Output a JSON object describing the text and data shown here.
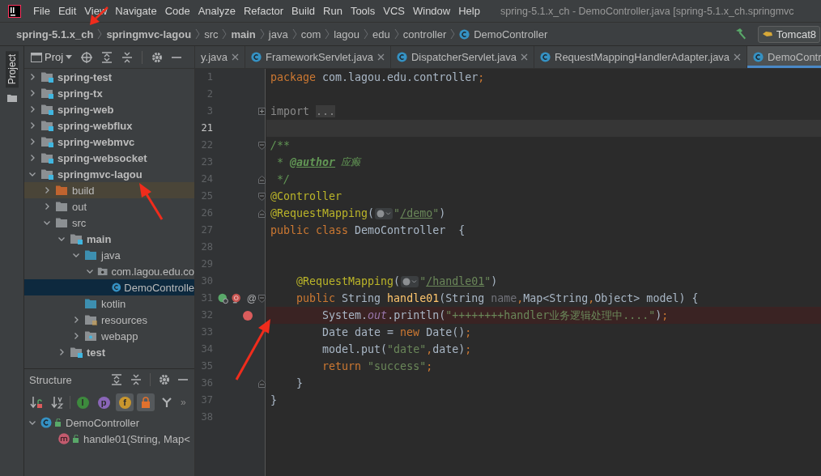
{
  "menu_bar": {
    "items": [
      "File",
      "Edit",
      "View",
      "Navigate",
      "Code",
      "Analyze",
      "Refactor",
      "Build",
      "Run",
      "Tools",
      "VCS",
      "Window",
      "Help"
    ],
    "window_title": "spring-5.1.x_ch - DemoController.java [spring-5.1.x_ch.springmvc"
  },
  "breadcrumb": {
    "items": [
      {
        "text": "spring-5.1.x_ch",
        "bold": true
      },
      {
        "text": "springmvc-lagou",
        "bold": true
      },
      {
        "text": "src",
        "bold": false
      },
      {
        "text": "main",
        "bold": true
      },
      {
        "text": "java",
        "bold": false
      },
      {
        "text": "com",
        "bold": false
      },
      {
        "text": "lagou",
        "bold": false
      },
      {
        "text": "edu",
        "bold": false
      },
      {
        "text": "controller",
        "bold": false
      },
      {
        "text": "DemoController",
        "bold": false,
        "kind": "class"
      }
    ],
    "run_config": "Tomcat8"
  },
  "side_stripe": {
    "tab": "Project"
  },
  "project_panel": {
    "view_selector": "Proj"
  },
  "project_tree": {
    "items": [
      {
        "text": "spring-test",
        "kind": "module",
        "expanded": false,
        "selected": false
      },
      {
        "text": "spring-tx",
        "kind": "module",
        "expanded": false,
        "selected": false
      },
      {
        "text": "spring-web",
        "kind": "module",
        "expanded": false,
        "selected": false
      },
      {
        "text": "spring-webflux",
        "kind": "module",
        "expanded": false,
        "selected": false
      },
      {
        "text": "spring-webmvc",
        "kind": "module",
        "expanded": false,
        "selected": false
      },
      {
        "text": "spring-websocket",
        "kind": "module",
        "expanded": false,
        "selected": false
      },
      {
        "text": "springmvc-lagou",
        "kind": "module",
        "expanded": true,
        "selected": false,
        "children": [
          {
            "text": "build",
            "kind": "excluded",
            "expanded": false,
            "selected": false
          },
          {
            "text": "out",
            "kind": "folder",
            "expanded": false,
            "selected": false
          },
          {
            "text": "src",
            "kind": "folder",
            "expanded": true,
            "selected": false,
            "children": [
              {
                "text": "main",
                "kind": "module-folder",
                "expanded": true,
                "selected": false,
                "children": [
                  {
                    "text": "java",
                    "kind": "source",
                    "expanded": true,
                    "selected": false,
                    "children": [
                      {
                        "text": "com.lagou.edu.co",
                        "kind": "package",
                        "expanded": true,
                        "selected": false,
                        "children": [
                          {
                            "text": "DemoControlle",
                            "kind": "class",
                            "selected": true
                          }
                        ]
                      }
                    ]
                  },
                  {
                    "text": "kotlin",
                    "kind": "source",
                    "selected": false
                  },
                  {
                    "text": "resources",
                    "kind": "resources",
                    "expanded": false,
                    "selected": false
                  },
                  {
                    "text": "webapp",
                    "kind": "web",
                    "expanded": false,
                    "selected": false
                  }
                ]
              },
              {
                "text": "test",
                "kind": "module-folder",
                "expanded": false,
                "selected": false
              }
            ]
          }
        ]
      }
    ]
  },
  "structure_panel": {
    "title": "Structure",
    "toolbar": [
      {
        "kind": "sort-visibility",
        "on": false
      },
      {
        "kind": "sort-alpha",
        "on": false
      },
      {
        "kind": "badge",
        "glyph": "I",
        "on": false
      },
      {
        "kind": "badge",
        "glyph": "p",
        "on": false
      },
      {
        "kind": "badge",
        "glyph": "f",
        "on": true
      },
      {
        "kind": "lock",
        "on": true
      },
      {
        "kind": "hierarchy",
        "on": false
      }
    ],
    "overflow": "»",
    "items": [
      {
        "text": "DemoController",
        "kind": "class",
        "expanded": true,
        "children": [
          {
            "text": "handle01(String, Map<",
            "kind": "method"
          }
        ]
      }
    ]
  },
  "editor_tabs": [
    {
      "text": "y.java",
      "kind": "plain",
      "selected": false,
      "closable": true
    },
    {
      "text": "FrameworkServlet.java",
      "kind": "class",
      "selected": false,
      "closable": true
    },
    {
      "text": "DispatcherServlet.java",
      "kind": "class",
      "selected": false,
      "closable": true
    },
    {
      "text": "RequestMappingHandlerAdapter.java",
      "kind": "class",
      "selected": false,
      "closable": true
    },
    {
      "text": "DemoContr",
      "kind": "class",
      "selected": true,
      "closable": false
    }
  ],
  "code_lines": [
    {
      "number": "1",
      "breakpoint": false,
      "current": false,
      "tokens": [
        {
          "kind": "keyword",
          "text": "package"
        },
        {
          "kind": "plain",
          "text": " com.lagou.edu.controller"
        },
        {
          "kind": "keyword",
          "text": ";"
        }
      ]
    },
    {
      "number": "2",
      "breakpoint": false,
      "current": false
    },
    {
      "number": "3",
      "breakpoint": false,
      "current": false,
      "fold": {
        "kind": "collapsed"
      },
      "tokens": [
        {
          "kind": "muted",
          "text": "import "
        },
        {
          "kind": "folded",
          "text": "..."
        }
      ]
    },
    {
      "number": "21",
      "breakpoint": false,
      "current": true
    },
    {
      "number": "22",
      "breakpoint": false,
      "current": false,
      "fold": {
        "kind": "open"
      },
      "tokens": [
        {
          "kind": "comment",
          "text": "/**"
        }
      ]
    },
    {
      "number": "23",
      "breakpoint": false,
      "current": false,
      "tokens": [
        {
          "kind": "comment",
          "text": " * "
        },
        {
          "kind": "doctag",
          "text": "@author"
        },
        {
          "kind": "doctext",
          "text": " 应癫"
        }
      ]
    },
    {
      "number": "24",
      "breakpoint": false,
      "current": false,
      "fold": {
        "kind": "close"
      },
      "tokens": [
        {
          "kind": "comment",
          "text": " */"
        }
      ]
    },
    {
      "number": "25",
      "breakpoint": false,
      "current": false,
      "fold": {
        "kind": "open"
      },
      "tokens": [
        {
          "kind": "annotation",
          "text": "@Controller"
        }
      ]
    },
    {
      "number": "26",
      "breakpoint": false,
      "current": false,
      "fold": {
        "kind": "close"
      },
      "tokens": [
        {
          "kind": "annotation",
          "text": "@RequestMapping"
        },
        {
          "kind": "plain",
          "text": "("
        },
        {
          "kind": "inlay"
        },
        {
          "kind": "string",
          "text": "\""
        },
        {
          "kind": "url",
          "text": "/demo"
        },
        {
          "kind": "string",
          "text": "\""
        },
        {
          "kind": "plain",
          "text": ")"
        }
      ]
    },
    {
      "number": "27",
      "breakpoint": false,
      "current": false,
      "tokens": [
        {
          "kind": "keyword",
          "text": "public class "
        },
        {
          "kind": "plain",
          "text": "DemoController  {"
        }
      ]
    },
    {
      "number": "28",
      "breakpoint": false,
      "current": false
    },
    {
      "number": "29",
      "breakpoint": false,
      "current": false
    },
    {
      "number": "30",
      "breakpoint": false,
      "current": false,
      "tokens": [
        {
          "kind": "annotation",
          "text": "    @RequestMapping"
        },
        {
          "kind": "plain",
          "text": "("
        },
        {
          "kind": "inlay"
        },
        {
          "kind": "string",
          "text": "\""
        },
        {
          "kind": "url",
          "text": "/handle01"
        },
        {
          "kind": "string",
          "text": "\""
        },
        {
          "kind": "plain",
          "text": ")"
        }
      ]
    },
    {
      "number": "31",
      "breakpoint": false,
      "current": false,
      "fold": {
        "kind": "open"
      },
      "gutter_icons": [
        {
          "kind": "bean"
        },
        {
          "kind": "mapping"
        }
      ],
      "gutter_mark": "@",
      "tokens": [
        {
          "kind": "keyword",
          "text": "    public "
        },
        {
          "kind": "plain",
          "text": "String "
        },
        {
          "kind": "method",
          "text": "handle01"
        },
        {
          "kind": "plain",
          "text": "(String "
        },
        {
          "kind": "unused",
          "text": "name"
        },
        {
          "kind": "keyword",
          "text": ","
        },
        {
          "kind": "plain",
          "text": "Map<String"
        },
        {
          "kind": "keyword",
          "text": ","
        },
        {
          "kind": "plain",
          "text": "Object> model) {"
        }
      ]
    },
    {
      "number": "32",
      "breakpoint": true,
      "current": false,
      "tokens": [
        {
          "kind": "plain",
          "text": "        System."
        },
        {
          "kind": "field",
          "text": "out"
        },
        {
          "kind": "plain",
          "text": ".println("
        },
        {
          "kind": "string",
          "text": "\"++++++++handler业务逻辑处理中....\""
        },
        {
          "kind": "plain",
          "text": ")"
        },
        {
          "kind": "keyword",
          "text": ";"
        }
      ]
    },
    {
      "number": "33",
      "breakpoint": false,
      "current": false,
      "tokens": [
        {
          "kind": "plain",
          "text": "        Date date = "
        },
        {
          "kind": "keyword",
          "text": "new "
        },
        {
          "kind": "plain",
          "text": "Date()"
        },
        {
          "kind": "keyword",
          "text": ";"
        }
      ]
    },
    {
      "number": "34",
      "breakpoint": false,
      "current": false,
      "tokens": [
        {
          "kind": "plain",
          "text": "        model.put("
        },
        {
          "kind": "string",
          "text": "\"date\""
        },
        {
          "kind": "keyword",
          "text": ","
        },
        {
          "kind": "plain",
          "text": "date)"
        },
        {
          "kind": "keyword",
          "text": ";"
        }
      ]
    },
    {
      "number": "35",
      "breakpoint": false,
      "current": false,
      "tokens": [
        {
          "kind": "keyword",
          "text": "        return "
        },
        {
          "kind": "string",
          "text": "\"success\""
        },
        {
          "kind": "keyword",
          "text": ";"
        }
      ]
    },
    {
      "number": "36",
      "breakpoint": false,
      "current": false,
      "fold": {
        "kind": "close"
      },
      "tokens": [
        {
          "kind": "plain",
          "text": "    }"
        }
      ]
    },
    {
      "number": "37",
      "breakpoint": false,
      "current": false,
      "tokens": [
        {
          "kind": "plain",
          "text": "}"
        }
      ]
    },
    {
      "number": "38",
      "breakpoint": false,
      "current": false
    }
  ]
}
